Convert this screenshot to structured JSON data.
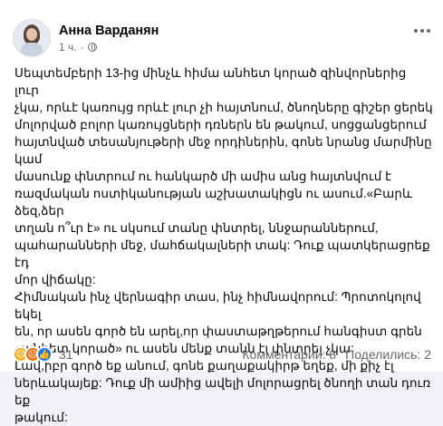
{
  "post": {
    "author": "Анна Варданян",
    "time": "1 ч.",
    "text": "Սեպտեմբերի 13-ից մինչև հիմա  անհետ կորած զինվորներից լուր\nչկա, որևէ կառույց որևէ լուր չի հայտնում, ծնողները գիշեր ցերեկ\nմոլորված բոլոր կառույցների դռներն են թակում, սոցցանցերում\nհայտնված տեսանյութերի մեջ որդիներին, գոնե նրանց մարմինը կամ\nմասունք փնտրում ու հանկարծ մի ամիս անց հայտնվում է\nռազմական ոստիկանության աշխատակիցն ու ասում.«Բարև ձեզ,ձեր\nտղան ո՞ւր է» ու սկսում տանը փնտրել, ննջարաններում,\nպահարանների մեջ, մահճակալների տակ: Դուք պատկերացրեք էդ\nմոր վիճակը:\nՀիմնական ինչ վերնագիր տաս, ինչ հիմնավորում: Պրոտոկոլով եկել\nեն, որ ասեն գործ են արել,որ փաստաթղթերում հանգիստ գրեն\n«անհետ կորած»  ու ասեն մենք տանն էլ փնտրել չկա:\nԼավ,իբր գործ եք անում, գոնե քաղաքակիրթ եղեք, մի քիչ էլ\nներևակայեք: Դուք մի ամիից ավելի մոլորացրել ծնողի տան դուռ եք\nթակում:",
    "reactions": {
      "count": "31",
      "icons": [
        "sad-reaction",
        "angry-reaction",
        "like-reaction"
      ],
      "colors": [
        "#f7b125",
        "#e9710f",
        "#1877f2"
      ]
    },
    "comments": "Комментарии: 8",
    "shares": "Поделились: 2"
  }
}
